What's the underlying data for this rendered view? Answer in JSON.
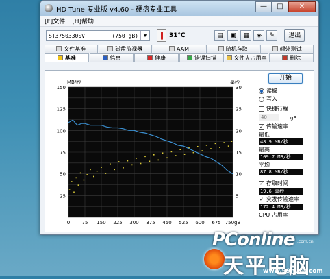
{
  "window": {
    "title": "HD Tune 专业版 v4.60 - 硬盘专业工具",
    "min_label": "—",
    "max_label": "□",
    "close_label": "✕"
  },
  "menu": {
    "items": [
      "[F]文件",
      "[H]帮助"
    ]
  },
  "toolbar": {
    "drive_name": "ST3750330SV",
    "drive_size": "(750 gB)",
    "temperature": "31℃",
    "exit_label": "退出"
  },
  "tabs": {
    "row1": [
      "文件基准",
      "磁盘监视器",
      "AAM",
      "随机存取",
      "额外测试"
    ],
    "row2": [
      "基准",
      "信息",
      "健康",
      "错误扫描",
      "文件夹占用率",
      "删除"
    ],
    "active": "基准"
  },
  "chart_data": {
    "type": "line",
    "xlabel": "",
    "left_unit": "MB/秒",
    "right_unit": "毫秒",
    "x_ticks": [
      "0",
      "75",
      "150",
      "225",
      "300",
      "375",
      "450",
      "525",
      "600",
      "675",
      "750gB"
    ],
    "y_left_ticks": [
      "150",
      "125",
      "100",
      "75",
      "50",
      "25"
    ],
    "y_right_ticks": [
      "30",
      "25",
      "20",
      "15",
      "10",
      "5"
    ],
    "xlim": [
      0,
      750
    ],
    "ylim_left": [
      0,
      150
    ],
    "ylim_right": [
      0,
      30
    ],
    "grid": true,
    "colors": {
      "transfer": "#3b8fd0",
      "access": "#d8c838",
      "background": "#0a0a0a",
      "grid": "#3c3c3c"
    },
    "series": [
      {
        "name": "传输速率",
        "axis": "left",
        "x": [
          0,
          20,
          40,
          60,
          75,
          100,
          125,
          150,
          175,
          200,
          225,
          250,
          275,
          300,
          325,
          350,
          375,
          400,
          425,
          450,
          475,
          500,
          525,
          550,
          575,
          600,
          625,
          650,
          675,
          700,
          725,
          750
        ],
        "y": [
          109,
          112,
          106,
          108,
          108,
          106,
          106,
          106,
          104,
          103,
          103,
          102,
          100,
          100,
          98,
          97,
          95,
          93,
          90,
          88,
          86,
          83,
          82,
          79,
          76,
          73,
          70,
          68,
          64,
          60,
          54,
          50
        ]
      },
      {
        "name": "存取时间",
        "axis": "right",
        "style": "scatter",
        "description_range": "points spread between ~5 and ~17 ms trending upward",
        "x": [
          5,
          15,
          25,
          35,
          45,
          55,
          70,
          85,
          100,
          115,
          130,
          150,
          170,
          190,
          210,
          230,
          250,
          270,
          290,
          310,
          330,
          350,
          370,
          390,
          410,
          430,
          450,
          470,
          490,
          510,
          530,
          550,
          570,
          590,
          610,
          630,
          650,
          670,
          690,
          710,
          730,
          745
        ],
        "y": [
          6.5,
          8.2,
          5.8,
          9.1,
          7.4,
          10.2,
          8.6,
          9.8,
          11.0,
          9.4,
          10.6,
          11.5,
          10.1,
          12.3,
          11.0,
          12.8,
          11.4,
          13.0,
          12.1,
          13.6,
          12.4,
          14.0,
          12.9,
          14.4,
          13.2,
          14.8,
          13.7,
          15.1,
          14.2,
          15.6,
          14.5,
          16.0,
          14.9,
          16.3,
          15.3,
          16.6,
          15.8,
          17.0,
          16.1,
          17.2,
          16.4,
          17.5
        ]
      }
    ]
  },
  "side": {
    "start_label": "开始",
    "read_label": "读取",
    "write_label": "写入",
    "fast_label": "快捷行程",
    "fast_value": "40",
    "fast_unit": "gB",
    "transfer_label": "传输速率",
    "min_label": "最低",
    "min_value": "48.9 MB/秒",
    "max_label": "最高",
    "max_value": "109.7 MB/秒",
    "avg_label": "平均",
    "avg_value": "87.8 MB/秒",
    "access_label": "存取时间",
    "access_value": "19.6 毫秒",
    "burst_label": "突发传输速率",
    "burst_value": "172.4 MB/秒",
    "cpu_label": "CPU 占用率"
  },
  "watermark": {
    "brand": "PConline",
    "com": ".com.cn",
    "big": "天平电脑",
    "url": "www.99hufu.com"
  }
}
